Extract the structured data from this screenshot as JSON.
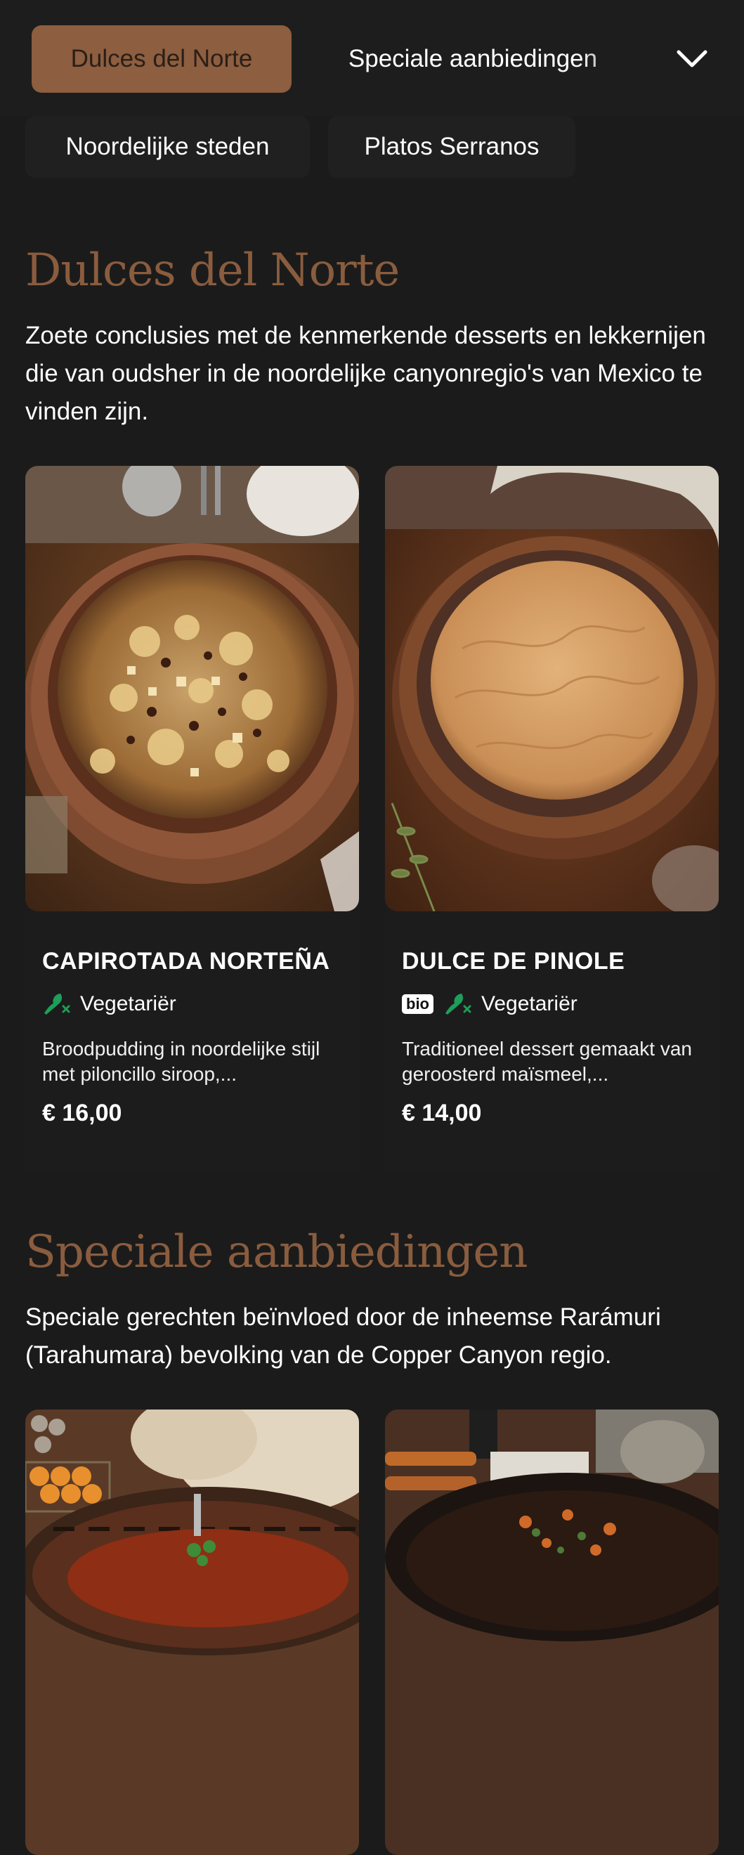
{
  "nav": {
    "tabs": [
      {
        "label": "Dulces del Norte",
        "active": true
      },
      {
        "label": "Speciale aanbiedingen",
        "active": false
      },
      {
        "label": "Noordelijke steden",
        "active": false
      },
      {
        "label": "Platos Serranos",
        "active": false
      }
    ],
    "expand_icon": "chevron-down-icon"
  },
  "sections": [
    {
      "title": "Dulces del Norte",
      "description": "Zoete conclusies met de kenmerkende desserts en lekkernijen die van oudsher in de noordelijke canyonregio's van Mexico te vinden zijn.",
      "items": [
        {
          "name": "CAPIROTADA NORTEÑA",
          "bio": false,
          "diet_label": "Vegetariër",
          "description": "Broodpudding in noordelijke stijl met piloncillo siroop,...",
          "price": "€ 16,00",
          "image": "bread-pudding-photo"
        },
        {
          "name": "DULCE DE PINOLE",
          "bio": true,
          "bio_label": "bio",
          "diet_label": "Vegetariër",
          "description": "Traditioneel dessert gemaakt van geroosterd maïsmeel,...",
          "price": "€ 14,00",
          "image": "pinole-dessert-photo"
        }
      ]
    },
    {
      "title": "Speciale aanbiedingen",
      "description": "Speciale gerechten beïnvloed door de inheemse Rarámuri (Tarahumara) bevolking van de Copper Canyon regio.",
      "items": [
        {
          "image": "stew-with-tortillas-photo"
        },
        {
          "image": "roasted-vegetables-skillet-photo"
        }
      ]
    }
  ],
  "colors": {
    "background": "#1b1b1b",
    "accent": "#8d5e3f",
    "title": "#8a5c3e",
    "veg_icon": "#1e9e5a"
  }
}
